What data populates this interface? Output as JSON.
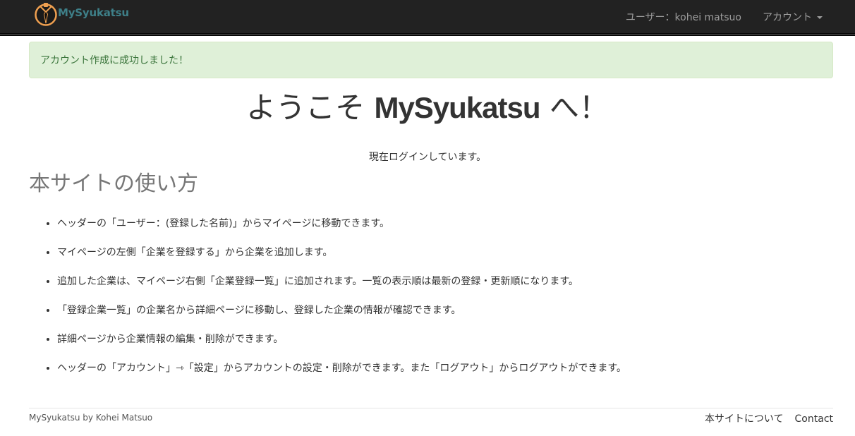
{
  "navbar": {
    "brand": "MySyukatsu",
    "user_link": "ユーザー：kohei matsuo",
    "account_menu": "アカウント"
  },
  "alert": {
    "message": "アカウント作成に成功しました！"
  },
  "hero": {
    "title_prefix": "ようこそ ",
    "title_brand": "MySyukatsu",
    "title_suffix": " へ！",
    "status": "現在ログインしています。"
  },
  "usage": {
    "heading": "本サイトの使い方",
    "items": [
      "ヘッダーの「ユーザー：(登録した名前)」からマイページに移動できます。",
      "マイページの左側「企業を登録する」から企業を追加します。",
      "追加した企業は、マイページ右側「企業登録一覧」に追加されます。一覧の表示順は最新の登録・更新順になります。",
      "「登録企業一覧」の企業名から詳細ページに移動し、登録した企業の情報が確認できます。",
      "詳細ページから企業情報の編集・削除ができます。",
      "ヘッダーの「アカウント」⇾「設定」からアカウントの設定・削除ができます。また「ログアウト」からログアウトができます。"
    ]
  },
  "footer": {
    "credit": "MySyukatsu by Kohei Matsuo",
    "about_link": "本サイトについて",
    "contact_link": "Contact"
  },
  "colors": {
    "navbar_bg": "#222222",
    "brand_text": "#3e7f88",
    "logo_ring": "#f0a050",
    "alert_bg": "#dff0d8",
    "alert_text": "#3c763d"
  },
  "icons": {
    "logo": "suit-and-tie-logo-icon",
    "account_dropdown": "caret-down-icon",
    "list_bullet": "disc-bullet-icon"
  }
}
